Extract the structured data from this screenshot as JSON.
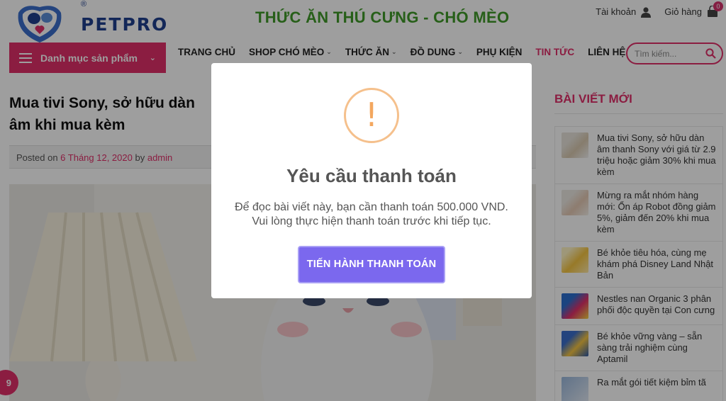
{
  "header": {
    "brand": "PETPRO",
    "site_title": "THỨC ĂN THÚ CƯNG - CHÓ MÈO",
    "account_label": "Tài khoản",
    "cart_label": "Giỏ hàng",
    "cart_count": "0"
  },
  "category_menu": {
    "label": "Danh mục sản phẩm"
  },
  "nav": {
    "items": [
      {
        "label": "TRANG CHỦ",
        "has_dropdown": false
      },
      {
        "label": "SHOP CHÓ MÈO",
        "has_dropdown": true
      },
      {
        "label": "THỨC ĂN",
        "has_dropdown": true
      },
      {
        "label": "ĐỒ DUNG",
        "has_dropdown": true
      },
      {
        "label": "PHỤ KIỆN",
        "has_dropdown": false
      },
      {
        "label": "TIN TỨC",
        "has_dropdown": false,
        "active": true
      },
      {
        "label": "LIÊN HỆ",
        "has_dropdown": false
      }
    ]
  },
  "search": {
    "placeholder": "Tìm kiếm..."
  },
  "article": {
    "title": "Mua tivi Sony, sở hữu dàn âm khi mua kèm",
    "posted_on_label": "Posted on",
    "date": "6 Tháng 12, 2020",
    "by_label": "by",
    "author": "admin"
  },
  "sidebar": {
    "heading": "BÀI VIẾT MỚI",
    "posts": [
      {
        "title": "Mua tivi Sony, sở hữu dàn âm thanh Sony với giá từ 2.9 triệu hoặc giảm 30% khi mua kèm"
      },
      {
        "title": "Mừng ra mắt nhóm hàng mới: Ổn áp Robot đồng giảm 5%, giảm đến 20% khi mua kèm"
      },
      {
        "title": "Bé khỏe tiêu hóa, cùng mẹ khám phá Disney Land Nhật Bản"
      },
      {
        "title": "Nestles nan Organic 3 phân phối độc quyền tại Con cưng"
      },
      {
        "title": "Bé khỏe vững vàng – sẵn sàng trải nghiệm cùng Aptamil"
      },
      {
        "title": "Ra mắt gói tiết kiệm bỉm tã"
      }
    ]
  },
  "chat_badge": "9",
  "modal": {
    "icon": "!",
    "title": "Yêu cầu thanh toán",
    "message_line1": "Để đọc bài viết này, bạn cần thanh toán 500.000 VND.",
    "message_line2": "Vui lòng thực hiện thanh toán trước khi tiếp tục.",
    "button_label": "TIẾN HÀNH THANH TOÁN"
  },
  "colors": {
    "accent_pink": "#e0306a",
    "title_green": "#3f9a29",
    "brand_blue": "#1f3f8f",
    "button_purple": "#7b68ee",
    "warning_orange": "#f3a75f"
  }
}
